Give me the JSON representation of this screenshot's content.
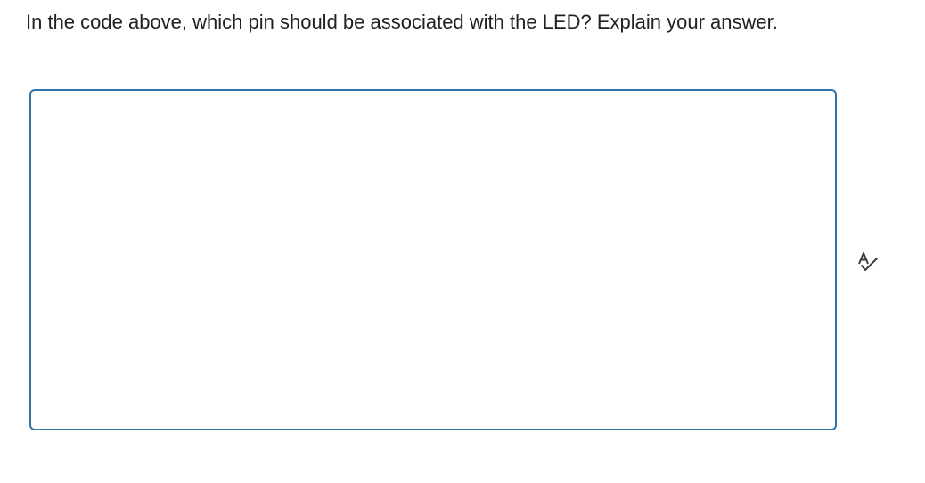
{
  "question": {
    "text": "In the code above, which pin should be associated with the LED?  Explain your answer."
  },
  "answer": {
    "value": "",
    "placeholder": ""
  },
  "icons": {
    "spellcheck": "spellcheck-icon"
  },
  "colors": {
    "text": "#202122",
    "border": "#2f74a6",
    "icon": "#3a3d41"
  }
}
